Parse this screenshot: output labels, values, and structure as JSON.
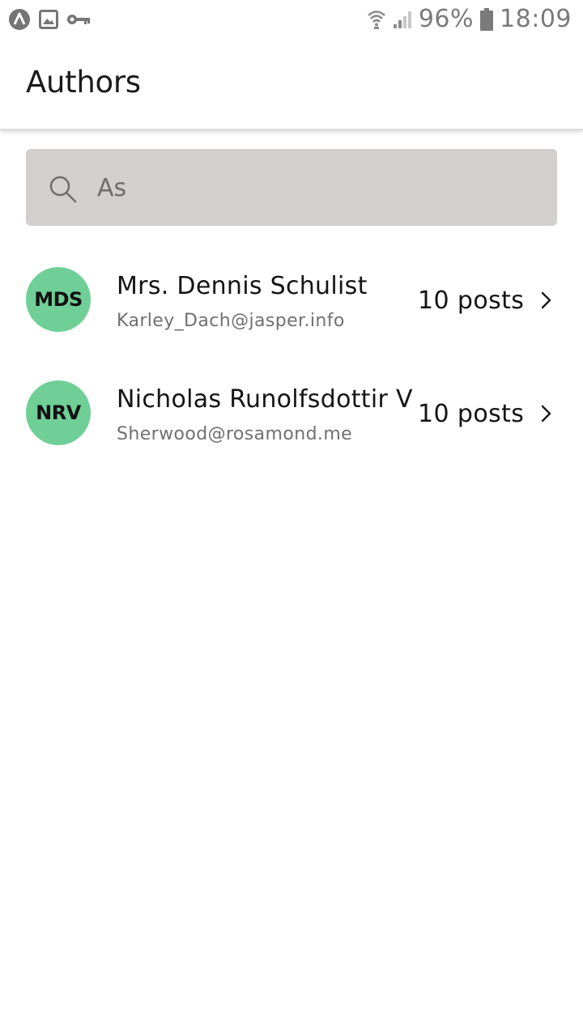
{
  "status_bar": {
    "battery_percent": "96%",
    "time": "18:09",
    "left_icons": [
      "app-logo-icon",
      "image-icon",
      "key-icon"
    ],
    "right_icons": [
      "wifi-icon",
      "signal-icon",
      "battery-icon"
    ]
  },
  "app_bar": {
    "title": "Authors"
  },
  "search": {
    "value": "As",
    "icon": "search-icon"
  },
  "authors": [
    {
      "initials": "MDS",
      "name": "Mrs. Dennis Schulist",
      "email": "Karley_Dach@jasper.info",
      "posts": "10 posts"
    },
    {
      "initials": "NRV",
      "name": "Nicholas Runolfsdottir V",
      "email": "Sherwood@rosamond.me",
      "posts": "10 posts"
    }
  ],
  "colors": {
    "avatar": "#6fcf97",
    "search_background": "#d2cfce",
    "status_icons": "#7a7a7a"
  }
}
